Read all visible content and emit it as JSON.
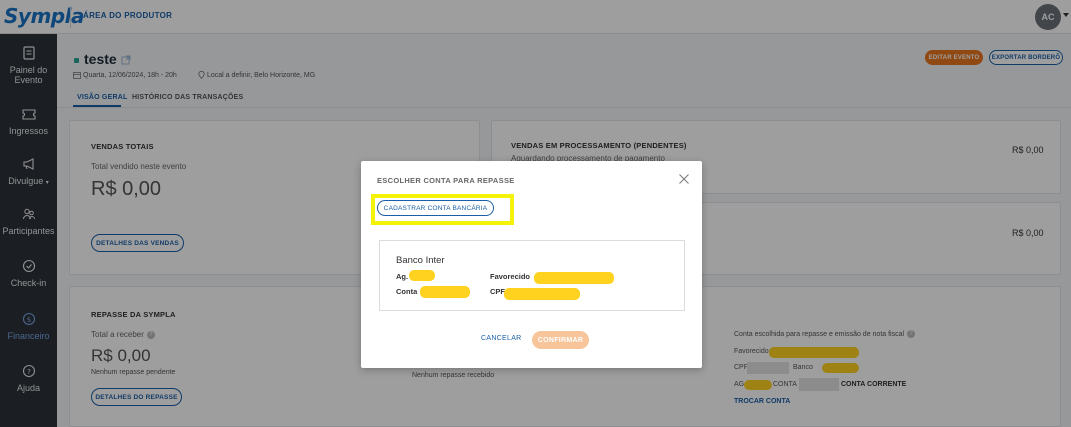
{
  "header": {
    "logo": "Sympla",
    "area_label": "ÁREA DO PRODUTOR",
    "avatar_initials": "AC"
  },
  "sidebar": {
    "items": [
      {
        "label_line1": "Painel do",
        "label_line2": "Evento",
        "icon": "document-icon"
      },
      {
        "label_line1": "Ingressos",
        "icon": "ticket-icon"
      },
      {
        "label_line1": "Divulgue",
        "caret": "▾",
        "icon": "megaphone-icon"
      },
      {
        "label_line1": "Participantes",
        "icon": "people-icon"
      },
      {
        "label_line1": "Check-in",
        "icon": "check-circle-icon"
      },
      {
        "label_line1": "Financeiro",
        "icon": "dollar-circle-icon",
        "active": true
      },
      {
        "label_line1": "Ajuda",
        "icon": "help-circle-icon"
      }
    ]
  },
  "event": {
    "title": "teste",
    "date": "Quarta, 12/06/2024, 18h - 20h",
    "location": "Local a definir, Belo Horizonte, MG",
    "edit_button": "EDITAR EVENTO",
    "export_button": "EXPORTAR BORDERÔ"
  },
  "tabs": [
    {
      "label": "VISÃO GERAL",
      "active": true
    },
    {
      "label": "HISTÓRICO DAS TRANSAÇÕES",
      "active": false
    }
  ],
  "cards": {
    "vendas_totais": {
      "title": "VENDAS TOTAIS",
      "subtitle": "Total vendido neste evento",
      "value": "R$ 0,00",
      "button": "DETALHES DAS VENDAS"
    },
    "vendas_processamento": {
      "title": "VENDAS EM PROCESSAMENTO (PENDENTES)",
      "subtitle": "Aguardando processamento de pagamento",
      "value": "R$ 0,00",
      "value2": "R$ 0,00"
    },
    "repasse": {
      "title": "REPASSE DA SYMPLA",
      "subtitle": "Total a receber",
      "value": "R$ 0,00",
      "note": "Nenhum repasse pendente",
      "button": "DETALHES DO REPASSE",
      "mid_note": "Nenhum repasse recebido",
      "account_note": "Conta escolhida para repasse e emissão de nota fiscal",
      "favorecido_label": "Favorecido",
      "cpf_label": "CPF",
      "banco_label": "Banco",
      "ag_label": "AG",
      "conta_label": "CONTA",
      "account_type": "CONTA CORRENTE",
      "change_link": "TROCAR CONTA"
    }
  },
  "modal": {
    "title": "ESCOLHER CONTA PARA REPASSE",
    "register_button": "CADASTRAR CONTA BANCÁRIA",
    "bank_name": "Banco Inter",
    "ag_label": "Ag.",
    "conta_label": "Conta",
    "favorecido_label": "Favorecido",
    "cpf_label": "CPF",
    "cancel_button": "CANCELAR",
    "confirm_button": "CONFIRMAR"
  },
  "colors": {
    "brand_blue": "#1a5fa8",
    "sidebar_bg": "#2d3138",
    "orange": "#e8771e",
    "highlight_yellow": "#f5f20a",
    "redaction_yellow": "#ffd21f"
  }
}
